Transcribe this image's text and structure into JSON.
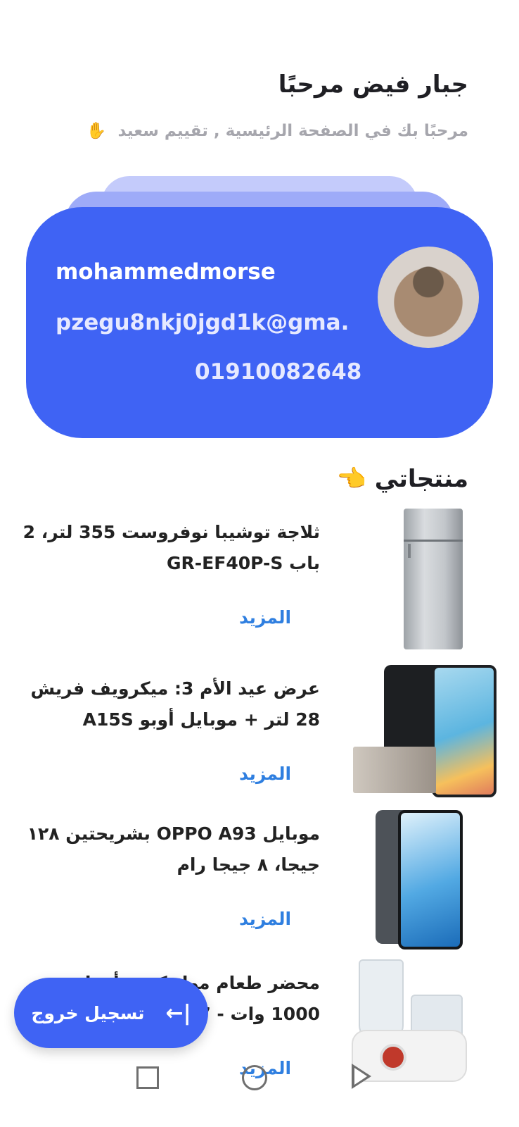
{
  "header": {
    "greeting": "جبار فيض مرحبًا",
    "subtitle": "مرحبًا بك في الصفحة الرئيسية , تقييم سعيد",
    "subtitle_emoji": "✋"
  },
  "profile": {
    "username": "mohammedmorse",
    "email": "pzegu8nkj0jgd1k@gma...",
    "phone": "01910082648",
    "avatar_icon": "pug-avatar"
  },
  "products_section": {
    "title": "منتجاتي",
    "emoji": "👈"
  },
  "products": [
    {
      "name": "ثلاجة توشيبا نوفروست 355 لتر، 2 باب GR-EF40P-S",
      "more_label": "المزيد",
      "image_icon": "fridge-image"
    },
    {
      "name": "عرض عيد الأم 3: ميكرويف فريش 28 لتر + موبايل أوبو A15S",
      "more_label": "المزيد",
      "image_icon": "phone-microwave-image"
    },
    {
      "name": "موبايل OPPO A93 بشريحتين ١٢٨ جيجا، ٨ جيجا رام",
      "more_label": "المزيد",
      "image_icon": "oppo-phone-image"
    },
    {
      "name": "محضر طعام مولينكس، أعداد مع 1000 وات - 27",
      "more_label": "المزيد",
      "image_icon": "food-processor-image"
    }
  ],
  "logout": {
    "label": "تسجيل خروج",
    "icon": "logout-arrow-icon"
  },
  "system_nav": {
    "icons": [
      "recent-apps-icon",
      "home-icon",
      "back-icon"
    ]
  },
  "colors": {
    "primary": "#3f63f4",
    "link": "#2f7fe0"
  }
}
